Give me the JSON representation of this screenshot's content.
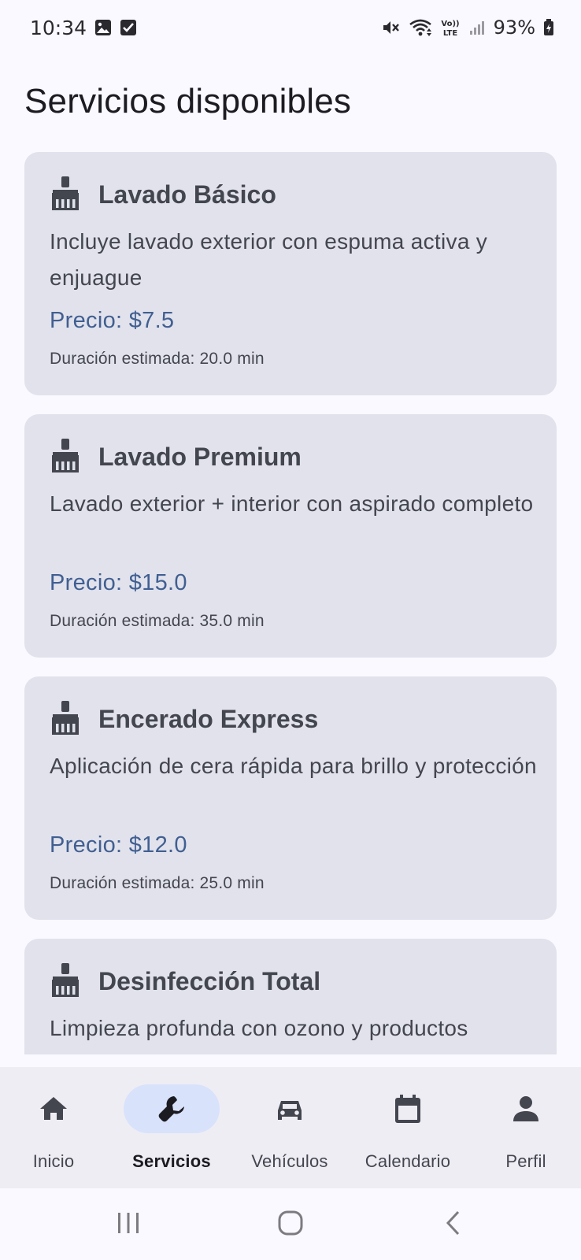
{
  "status_bar": {
    "time": "10:34",
    "battery_percent": "93%",
    "left_icons": [
      "gallery-icon",
      "checkbox-icon"
    ],
    "right_icons": [
      "mute-icon",
      "wifi-icon",
      "volte-icon",
      "signal-icon",
      "battery-icon"
    ],
    "volte_label_top": "Vo))",
    "volte_label_bottom": "LTE"
  },
  "page": {
    "title": "Servicios disponibles"
  },
  "services": [
    {
      "icon": "broom-icon",
      "name": "Lavado Básico",
      "description": "Incluye lavado exterior con espuma activa y enjuague",
      "price": "Precio: $7.5",
      "duration": "Duración estimada: 20.0 min"
    },
    {
      "icon": "broom-icon",
      "name": "Lavado Premium",
      "description": "Lavado exterior + interior con aspirado completo",
      "price": "Precio: $15.0",
      "duration": "Duración estimada: 35.0 min"
    },
    {
      "icon": "broom-icon",
      "name": "Encerado Express",
      "description": "Aplicación de cera rápida para brillo y protección",
      "price": "Precio: $12.0",
      "duration": "Duración estimada: 25.0 min"
    },
    {
      "icon": "broom-icon",
      "name": "Desinfección Total",
      "description": "Limpieza profunda con ozono y productos antibacteriales"
    }
  ],
  "bottom_nav": {
    "active": "Servicios",
    "items": [
      {
        "label": "Inicio",
        "icon": "home-icon"
      },
      {
        "label": "Servicios",
        "icon": "wrench-icon"
      },
      {
        "label": "Vehículos",
        "icon": "car-icon"
      },
      {
        "label": "Calendario",
        "icon": "calendar-icon"
      },
      {
        "label": "Perfil",
        "icon": "person-icon"
      }
    ]
  },
  "system_nav": {
    "buttons": [
      "recent-apps-icon",
      "home-button-icon",
      "back-icon"
    ]
  },
  "colors": {
    "background": "#f9f9ff",
    "card": "#e1e2ec",
    "card_text": "#44464f",
    "price": "#415f91",
    "nav_background": "#eeedf4",
    "nav_active_indicator": "#d9e2fb"
  }
}
